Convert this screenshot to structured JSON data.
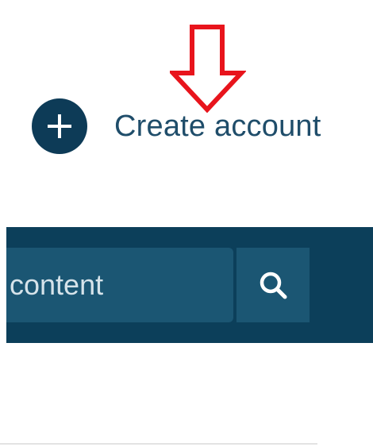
{
  "create_account": {
    "icon": "plus-icon",
    "label": "Create account"
  },
  "search": {
    "value": "content",
    "icon": "search-icon"
  },
  "annotation": {
    "icon": "down-arrow-icon",
    "color": "#e8141c"
  },
  "colors": {
    "header_bg": "#0c3f5a",
    "input_bg": "#1b5673",
    "button_bg": "#0d3b57",
    "label": "#1f4d6a"
  }
}
